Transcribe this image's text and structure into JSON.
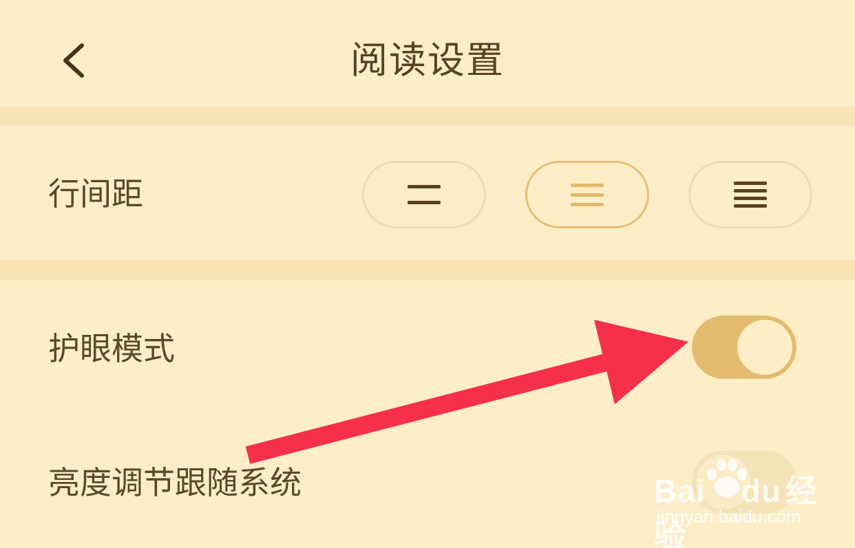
{
  "header": {
    "title": "阅读设置",
    "back_icon": "chevron-left-icon"
  },
  "settings": {
    "line_spacing": {
      "label": "行间距",
      "options": [
        {
          "icon": "line-spacing-wide-icon",
          "lines": 2,
          "selected": false
        },
        {
          "icon": "line-spacing-medium-icon",
          "lines": 3,
          "selected": true
        },
        {
          "icon": "line-spacing-narrow-icon",
          "lines": 4,
          "selected": false
        }
      ]
    },
    "eye_protection": {
      "label": "护眼模式",
      "enabled": true
    },
    "brightness_follow_system": {
      "label": "亮度调节跟随系统",
      "enabled": false
    }
  },
  "annotation": {
    "icon": "red-arrow-icon",
    "color": "#f7304a"
  },
  "watermark": {
    "brand": "Bai",
    "brand_suffix": "du",
    "product": "经验",
    "url": "jingyan.baidu.com"
  },
  "colors": {
    "background": "#fdeec8",
    "divider": "#f7e3b6",
    "accent": "#e2bb6e",
    "text": "#5e4727"
  }
}
